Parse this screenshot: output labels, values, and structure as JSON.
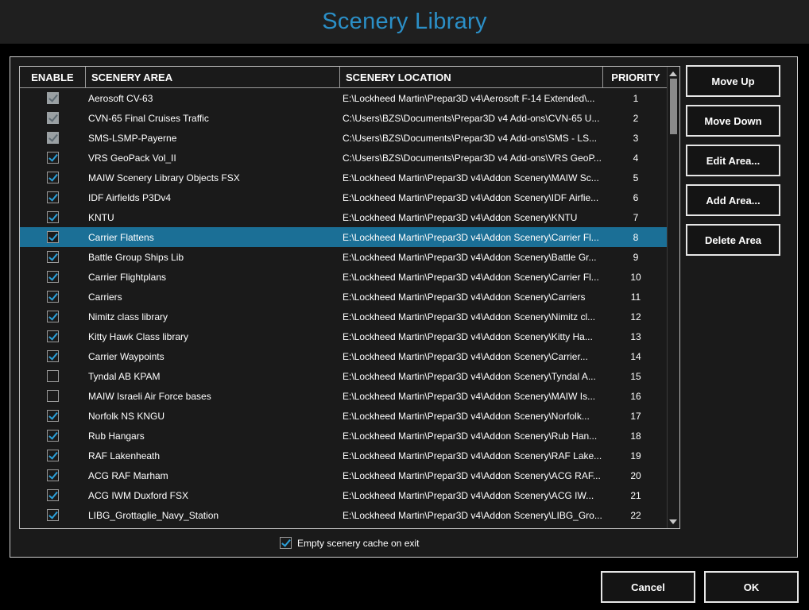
{
  "window": {
    "title": "Scenery Library"
  },
  "table": {
    "headers": {
      "enable": "ENABLE",
      "area": "SCENERY AREA",
      "location": "SCENERY LOCATION",
      "priority": "PRIORITY"
    },
    "rows": [
      {
        "enabled": true,
        "locked": true,
        "area": "Aerosoft CV-63",
        "location": "E:\\Lockheed Martin\\Prepar3D v4\\Aerosoft F-14 Extended\\...",
        "priority": "1"
      },
      {
        "enabled": true,
        "locked": true,
        "area": "CVN-65 Final Cruises Traffic",
        "location": "C:\\Users\\BZS\\Documents\\Prepar3D v4 Add-ons\\CVN-65 U...",
        "priority": "2"
      },
      {
        "enabled": true,
        "locked": true,
        "area": "SMS-LSMP-Payerne",
        "location": "C:\\Users\\BZS\\Documents\\Prepar3D v4 Add-ons\\SMS - LS...",
        "priority": "3"
      },
      {
        "enabled": true,
        "locked": false,
        "area": "VRS GeoPack Vol_II",
        "location": "C:\\Users\\BZS\\Documents\\Prepar3D v4 Add-ons\\VRS GeoP...",
        "priority": "4"
      },
      {
        "enabled": true,
        "locked": false,
        "area": "MAIW Scenery Library Objects FSX",
        "location": "E:\\Lockheed Martin\\Prepar3D v4\\Addon Scenery\\MAIW Sc...",
        "priority": "5"
      },
      {
        "enabled": true,
        "locked": false,
        "area": "IDF Airfields P3Dv4",
        "location": "E:\\Lockheed Martin\\Prepar3D v4\\Addon Scenery\\IDF Airfie...",
        "priority": "6"
      },
      {
        "enabled": true,
        "locked": false,
        "area": "KNTU",
        "location": "E:\\Lockheed Martin\\Prepar3D v4\\Addon Scenery\\KNTU",
        "priority": "7"
      },
      {
        "enabled": true,
        "locked": false,
        "area": "Carrier Flattens",
        "location": "E:\\Lockheed Martin\\Prepar3D v4\\Addon Scenery\\Carrier Fl...",
        "priority": "8",
        "selected": true
      },
      {
        "enabled": true,
        "locked": false,
        "area": "Battle Group Ships Lib",
        "location": "E:\\Lockheed Martin\\Prepar3D v4\\Addon Scenery\\Battle Gr...",
        "priority": "9"
      },
      {
        "enabled": true,
        "locked": false,
        "area": "Carrier Flightplans",
        "location": "E:\\Lockheed Martin\\Prepar3D v4\\Addon Scenery\\Carrier Fl...",
        "priority": "10"
      },
      {
        "enabled": true,
        "locked": false,
        "area": "Carriers",
        "location": "E:\\Lockheed Martin\\Prepar3D v4\\Addon Scenery\\Carriers",
        "priority": "11"
      },
      {
        "enabled": true,
        "locked": false,
        "area": "Nimitz class library",
        "location": "E:\\Lockheed Martin\\Prepar3D v4\\Addon Scenery\\Nimitz cl...",
        "priority": "12"
      },
      {
        "enabled": true,
        "locked": false,
        "area": "Kitty Hawk Class library",
        "location": "E:\\Lockheed Martin\\Prepar3D v4\\Addon Scenery\\Kitty Ha...",
        "priority": "13"
      },
      {
        "enabled": true,
        "locked": false,
        "area": "Carrier Waypoints",
        "location": "E:\\Lockheed Martin\\Prepar3D v4\\Addon Scenery\\Carrier...",
        "priority": "14"
      },
      {
        "enabled": false,
        "locked": false,
        "area": "Tyndal AB KPAM",
        "location": "E:\\Lockheed Martin\\Prepar3D v4\\Addon Scenery\\Tyndal A...",
        "priority": "15"
      },
      {
        "enabled": false,
        "locked": false,
        "area": "MAIW Israeli Air Force bases",
        "location": "E:\\Lockheed Martin\\Prepar3D v4\\Addon Scenery\\MAIW Is...",
        "priority": "16"
      },
      {
        "enabled": true,
        "locked": false,
        "area": "Norfolk NS KNGU",
        "location": "E:\\Lockheed Martin\\Prepar3D v4\\Addon Scenery\\Norfolk...",
        "priority": "17"
      },
      {
        "enabled": true,
        "locked": false,
        "area": "Rub Hangars",
        "location": "E:\\Lockheed Martin\\Prepar3D v4\\Addon Scenery\\Rub Han...",
        "priority": "18"
      },
      {
        "enabled": true,
        "locked": false,
        "area": "RAF Lakenheath",
        "location": "E:\\Lockheed Martin\\Prepar3D v4\\Addon Scenery\\RAF Lake...",
        "priority": "19"
      },
      {
        "enabled": true,
        "locked": false,
        "area": "ACG RAF Marham",
        "location": "E:\\Lockheed Martin\\Prepar3D v4\\Addon Scenery\\ACG RAF...",
        "priority": "20"
      },
      {
        "enabled": true,
        "locked": false,
        "area": "ACG IWM Duxford FSX",
        "location": "E:\\Lockheed Martin\\Prepar3D v4\\Addon Scenery\\ACG IW...",
        "priority": "21"
      },
      {
        "enabled": true,
        "locked": false,
        "area": "LIBG_Grottaglie_Navy_Station",
        "location": "E:\\Lockheed Martin\\Prepar3D v4\\Addon Scenery\\LIBG_Gro...",
        "priority": "22"
      }
    ]
  },
  "side_buttons": {
    "move_up": "Move Up",
    "move_down": "Move Down",
    "edit_area": "Edit Area...",
    "add_area": "Add Area...",
    "delete_area": "Delete Area"
  },
  "options": {
    "empty_cache_label": "Empty scenery cache on exit",
    "empty_cache_checked": true
  },
  "footer": {
    "cancel": "Cancel",
    "ok": "OK"
  },
  "colors": {
    "accent": "#2b8fc7",
    "selection": "#1b6f96"
  }
}
